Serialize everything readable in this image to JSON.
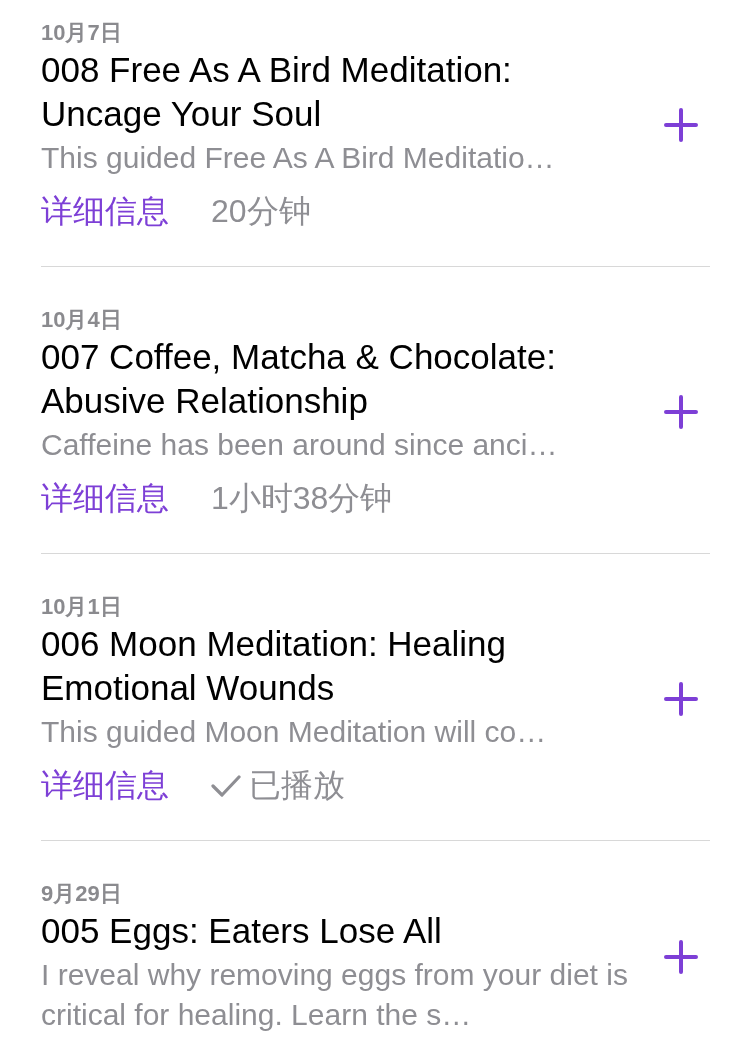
{
  "episodes": [
    {
      "date": "10月7日",
      "title": "008 Free As A Bird Meditation: Uncage Your Soul",
      "description": "This guided Free As A Bird Meditatio…",
      "details_link": "详细信息",
      "meta": "20分钟",
      "played": false
    },
    {
      "date": "10月4日",
      "title": "007 Coffee, Matcha & Chocolate: Abusive Relationship",
      "description": "Caffeine has been around since anci…",
      "details_link": "详细信息",
      "meta": "1小时38分钟",
      "played": false
    },
    {
      "date": "10月1日",
      "title": "006 Moon Meditation: Healing Emotional Wounds",
      "description": "This guided Moon Meditation will co…",
      "details_link": "详细信息",
      "meta": "已播放",
      "played": true
    },
    {
      "date": "9月29日",
      "title": "005 Eggs: Eaters Lose All",
      "description": "I reveal why removing eggs from your diet is critical for healing. Learn the s…"
    }
  ]
}
